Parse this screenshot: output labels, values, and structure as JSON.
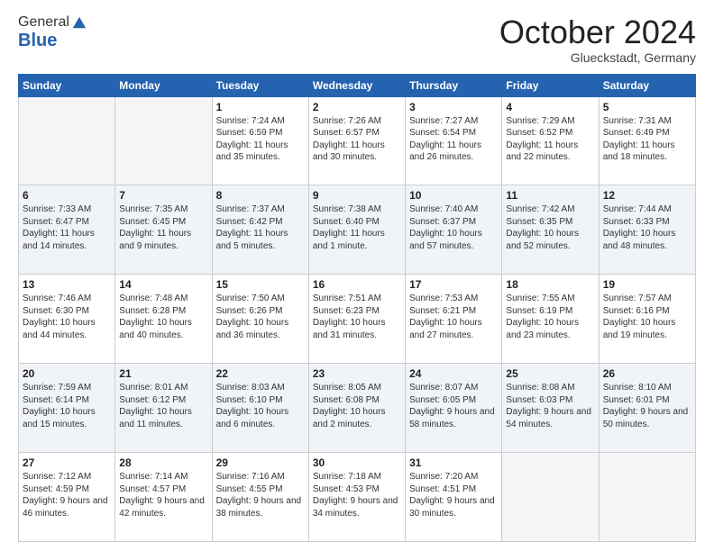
{
  "logo": {
    "general": "General",
    "blue": "Blue"
  },
  "header": {
    "month": "October 2024",
    "location": "Glueckstadt, Germany"
  },
  "weekdays": [
    "Sunday",
    "Monday",
    "Tuesday",
    "Wednesday",
    "Thursday",
    "Friday",
    "Saturday"
  ],
  "weeks": [
    [
      {
        "day": "",
        "info": ""
      },
      {
        "day": "",
        "info": ""
      },
      {
        "day": "1",
        "info": "Sunrise: 7:24 AM\nSunset: 6:59 PM\nDaylight: 11 hours and 35 minutes."
      },
      {
        "day": "2",
        "info": "Sunrise: 7:26 AM\nSunset: 6:57 PM\nDaylight: 11 hours and 30 minutes."
      },
      {
        "day": "3",
        "info": "Sunrise: 7:27 AM\nSunset: 6:54 PM\nDaylight: 11 hours and 26 minutes."
      },
      {
        "day": "4",
        "info": "Sunrise: 7:29 AM\nSunset: 6:52 PM\nDaylight: 11 hours and 22 minutes."
      },
      {
        "day": "5",
        "info": "Sunrise: 7:31 AM\nSunset: 6:49 PM\nDaylight: 11 hours and 18 minutes."
      }
    ],
    [
      {
        "day": "6",
        "info": "Sunrise: 7:33 AM\nSunset: 6:47 PM\nDaylight: 11 hours and 14 minutes."
      },
      {
        "day": "7",
        "info": "Sunrise: 7:35 AM\nSunset: 6:45 PM\nDaylight: 11 hours and 9 minutes."
      },
      {
        "day": "8",
        "info": "Sunrise: 7:37 AM\nSunset: 6:42 PM\nDaylight: 11 hours and 5 minutes."
      },
      {
        "day": "9",
        "info": "Sunrise: 7:38 AM\nSunset: 6:40 PM\nDaylight: 11 hours and 1 minute."
      },
      {
        "day": "10",
        "info": "Sunrise: 7:40 AM\nSunset: 6:37 PM\nDaylight: 10 hours and 57 minutes."
      },
      {
        "day": "11",
        "info": "Sunrise: 7:42 AM\nSunset: 6:35 PM\nDaylight: 10 hours and 52 minutes."
      },
      {
        "day": "12",
        "info": "Sunrise: 7:44 AM\nSunset: 6:33 PM\nDaylight: 10 hours and 48 minutes."
      }
    ],
    [
      {
        "day": "13",
        "info": "Sunrise: 7:46 AM\nSunset: 6:30 PM\nDaylight: 10 hours and 44 minutes."
      },
      {
        "day": "14",
        "info": "Sunrise: 7:48 AM\nSunset: 6:28 PM\nDaylight: 10 hours and 40 minutes."
      },
      {
        "day": "15",
        "info": "Sunrise: 7:50 AM\nSunset: 6:26 PM\nDaylight: 10 hours and 36 minutes."
      },
      {
        "day": "16",
        "info": "Sunrise: 7:51 AM\nSunset: 6:23 PM\nDaylight: 10 hours and 31 minutes."
      },
      {
        "day": "17",
        "info": "Sunrise: 7:53 AM\nSunset: 6:21 PM\nDaylight: 10 hours and 27 minutes."
      },
      {
        "day": "18",
        "info": "Sunrise: 7:55 AM\nSunset: 6:19 PM\nDaylight: 10 hours and 23 minutes."
      },
      {
        "day": "19",
        "info": "Sunrise: 7:57 AM\nSunset: 6:16 PM\nDaylight: 10 hours and 19 minutes."
      }
    ],
    [
      {
        "day": "20",
        "info": "Sunrise: 7:59 AM\nSunset: 6:14 PM\nDaylight: 10 hours and 15 minutes."
      },
      {
        "day": "21",
        "info": "Sunrise: 8:01 AM\nSunset: 6:12 PM\nDaylight: 10 hours and 11 minutes."
      },
      {
        "day": "22",
        "info": "Sunrise: 8:03 AM\nSunset: 6:10 PM\nDaylight: 10 hours and 6 minutes."
      },
      {
        "day": "23",
        "info": "Sunrise: 8:05 AM\nSunset: 6:08 PM\nDaylight: 10 hours and 2 minutes."
      },
      {
        "day": "24",
        "info": "Sunrise: 8:07 AM\nSunset: 6:05 PM\nDaylight: 9 hours and 58 minutes."
      },
      {
        "day": "25",
        "info": "Sunrise: 8:08 AM\nSunset: 6:03 PM\nDaylight: 9 hours and 54 minutes."
      },
      {
        "day": "26",
        "info": "Sunrise: 8:10 AM\nSunset: 6:01 PM\nDaylight: 9 hours and 50 minutes."
      }
    ],
    [
      {
        "day": "27",
        "info": "Sunrise: 7:12 AM\nSunset: 4:59 PM\nDaylight: 9 hours and 46 minutes."
      },
      {
        "day": "28",
        "info": "Sunrise: 7:14 AM\nSunset: 4:57 PM\nDaylight: 9 hours and 42 minutes."
      },
      {
        "day": "29",
        "info": "Sunrise: 7:16 AM\nSunset: 4:55 PM\nDaylight: 9 hours and 38 minutes."
      },
      {
        "day": "30",
        "info": "Sunrise: 7:18 AM\nSunset: 4:53 PM\nDaylight: 9 hours and 34 minutes."
      },
      {
        "day": "31",
        "info": "Sunrise: 7:20 AM\nSunset: 4:51 PM\nDaylight: 9 hours and 30 minutes."
      },
      {
        "day": "",
        "info": ""
      },
      {
        "day": "",
        "info": ""
      }
    ]
  ]
}
